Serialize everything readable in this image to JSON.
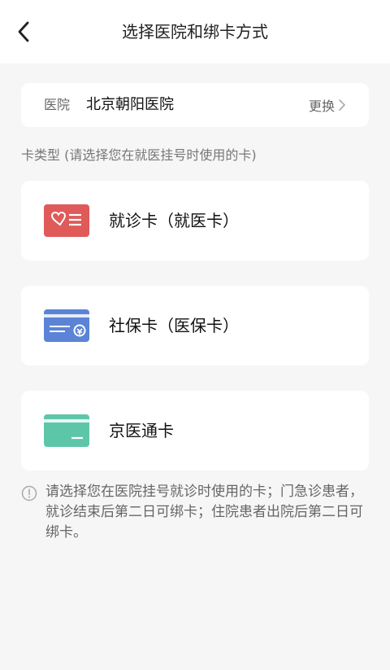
{
  "nav": {
    "title": "选择医院和绑卡方式"
  },
  "hospital": {
    "label": "医院",
    "name": "北京朝阳医院",
    "change_label": "更换"
  },
  "section": {
    "label": "卡类型 (请选择您在就医挂号时使用的卡)"
  },
  "card_options": [
    {
      "title": "就诊卡（就医卡）",
      "icon": "visit-card-icon",
      "color": "#e05a5a"
    },
    {
      "title": "社保卡（医保卡）",
      "icon": "social-security-card-icon",
      "color": "#5b84d6"
    },
    {
      "title": "京医通卡",
      "icon": "jingyitong-card-icon",
      "color": "#5ec6a8"
    }
  ],
  "notice": {
    "icon": "info-icon",
    "text": "请选择您在医院挂号就诊时使用的卡；门急诊患者，就诊结束后第二日可绑卡；住院患者出院后第二日可绑卡。"
  }
}
